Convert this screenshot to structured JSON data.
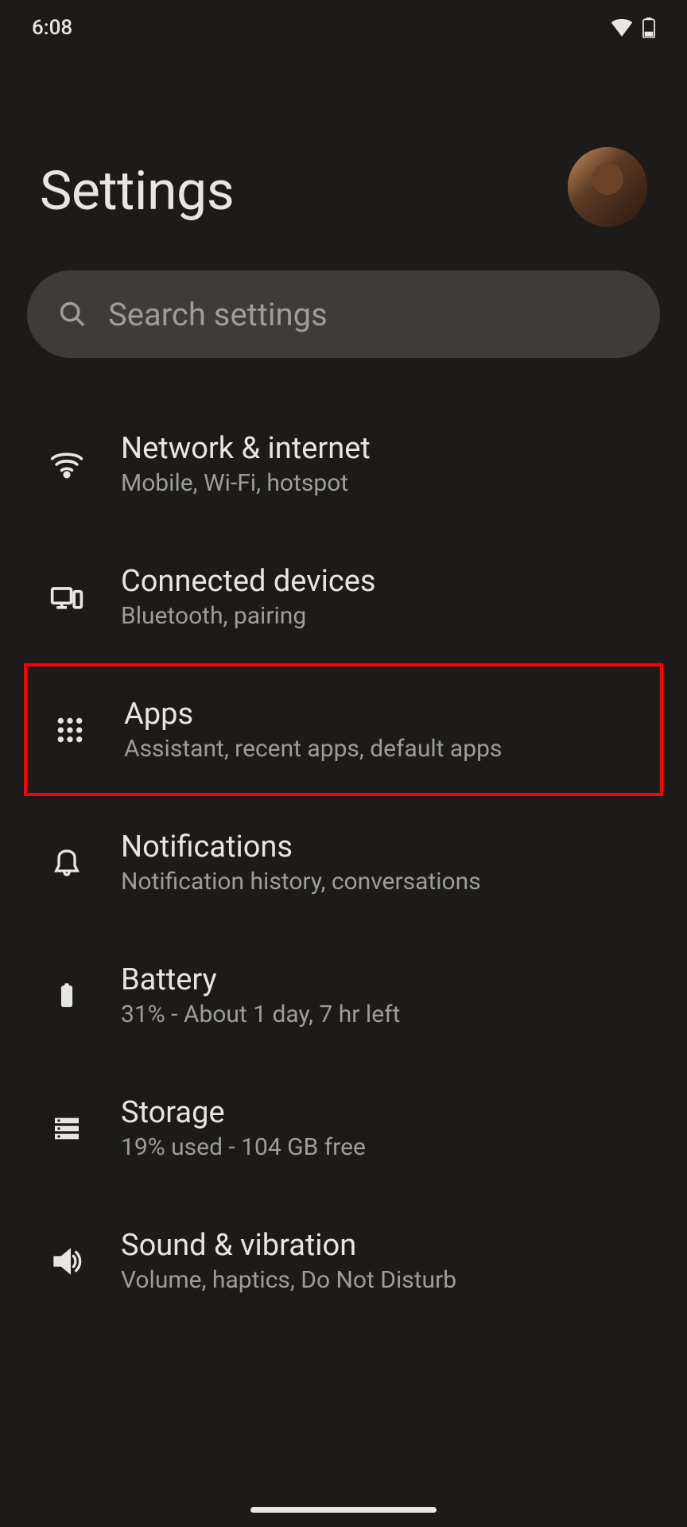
{
  "statusBar": {
    "time": "6:08"
  },
  "page": {
    "title": "Settings"
  },
  "search": {
    "placeholder": "Search settings"
  },
  "items": [
    {
      "title": "Network & internet",
      "subtitle": "Mobile, Wi-Fi, hotspot"
    },
    {
      "title": "Connected devices",
      "subtitle": "Bluetooth, pairing"
    },
    {
      "title": "Apps",
      "subtitle": "Assistant, recent apps, default apps"
    },
    {
      "title": "Notifications",
      "subtitle": "Notification history, conversations"
    },
    {
      "title": "Battery",
      "subtitle": "31% - About 1 day, 7 hr left"
    },
    {
      "title": "Storage",
      "subtitle": "19% used - 104 GB free"
    },
    {
      "title": "Sound & vibration",
      "subtitle": "Volume, haptics, Do Not Disturb"
    }
  ]
}
